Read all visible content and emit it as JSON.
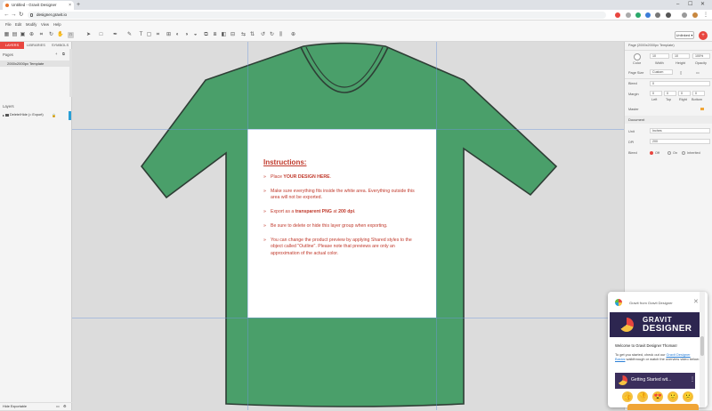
{
  "browser": {
    "tab_title": "Untitled - Gravit Designer",
    "tab_close": "×",
    "new_tab": "+",
    "url": "designer.gravit.io",
    "window_controls": [
      "–",
      "☐",
      "✕"
    ]
  },
  "menubar": {
    "items": [
      "File",
      "Edit",
      "Modify",
      "View",
      "Help"
    ]
  },
  "toolbar": {
    "unlinked_label": "Unlinked ▾"
  },
  "left_panel": {
    "tabs": [
      "LAYERS",
      "LIBRARIES",
      "SYMBOLS"
    ],
    "pages_label": "Pages",
    "page_item": "2000x2000px Template",
    "layers_label": "Layers",
    "layer_item": "Delete/Hide (= Export)",
    "footer_label": "Hide Exportable"
  },
  "canvas": {
    "instructions_title": "Instructions:",
    "instructions": [
      {
        "pre": "Place ",
        "bold": "YOUR DESIGN HERE",
        "post": "."
      },
      {
        "pre": "Make sure everything fits inside the white area. Everything outside this area will not be exported.",
        "bold": "",
        "post": ""
      },
      {
        "pre": "Export as a ",
        "bold": "transparent PNG",
        "post": " at ",
        "bold2": "200 dpi",
        "post2": "."
      },
      {
        "pre": "Be sure to delete or hide this layer group when exporting.",
        "bold": "",
        "post": ""
      },
      {
        "pre": "You can change the product preview by applying Shared styles to the object called \"Outline\". Please note that previews are only an approximation of the actual color.",
        "bold": "",
        "post": ""
      }
    ],
    "shirt_color": "#4a9f6a",
    "instructions_color": "#c0392b"
  },
  "right_panel": {
    "page_header": "Page (2000x2000px Template)",
    "size_labels": [
      "Color",
      "Width",
      "Height",
      "Opacity"
    ],
    "width_value": "10",
    "height_value": "10",
    "zoom_value": "100%",
    "page_size_label": "Page Size",
    "page_size_value": "Custom",
    "bleed_label": "Bleed",
    "bleed_value": "0",
    "margin_label": "Margin",
    "margin_values": [
      "0",
      "0",
      "0",
      "0"
    ],
    "margin_sublabels": [
      "Left",
      "Top",
      "Right",
      "Bottom"
    ],
    "master_label": "Master",
    "document_header": "Document",
    "unit_label": "Unit",
    "unit_value": "Inches",
    "dpi_label": "DPI",
    "dpi_value": "200",
    "bleed2_label": "Bleed",
    "bleed2_options": [
      "Off",
      "On",
      "Inherited"
    ]
  },
  "popup": {
    "from_label": "Gravit from Gravit Designer",
    "close": "✕",
    "banner_line1": "GRAVIT",
    "banner_line2": "DESIGNER",
    "welcome": "Welcome to Gravit Designer Thomas!",
    "body_pre": "To get you started, check out our ",
    "body_link": "Gravit Designer Basics",
    "body_post": " walkthrough or watch the overview video below:",
    "video_title": "Getting Started wit...",
    "video_menu": "⋮",
    "reactions": [
      "👍",
      "👎",
      "😍",
      "🙂",
      "😕"
    ]
  }
}
